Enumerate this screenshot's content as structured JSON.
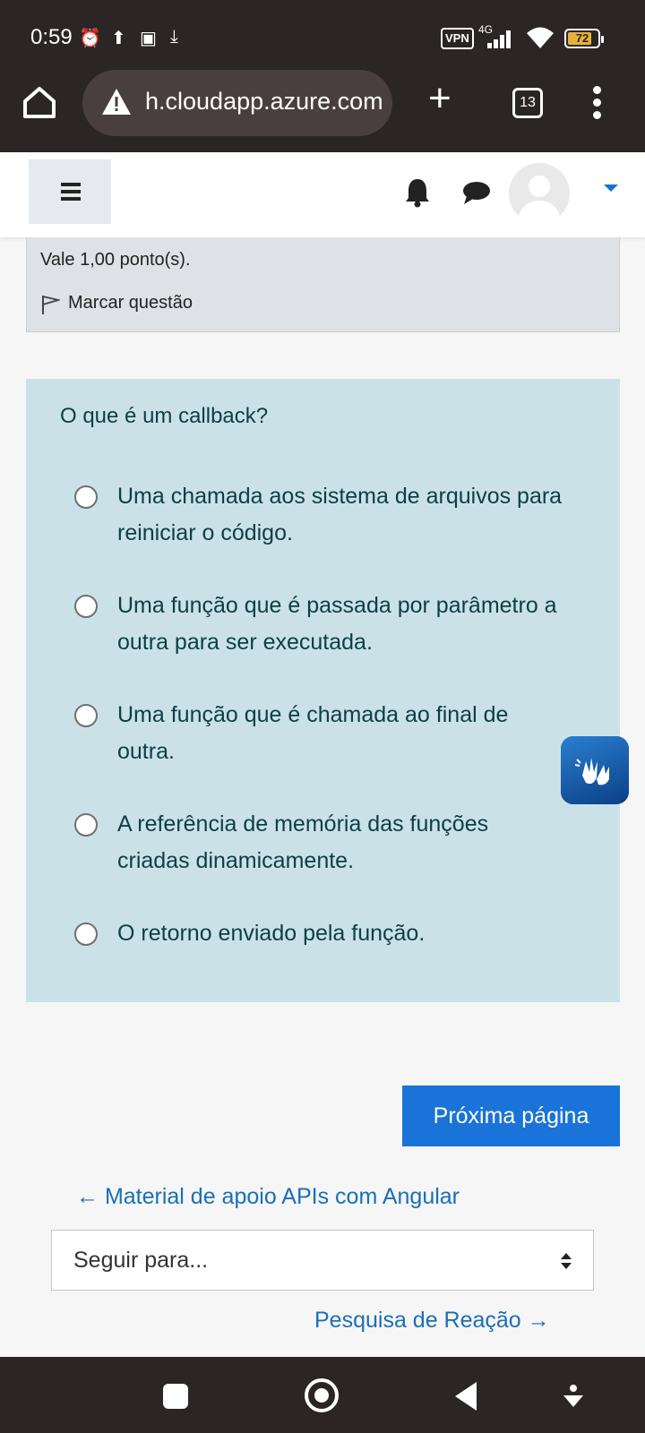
{
  "status_bar": {
    "time": "0:59",
    "vpn": "VPN",
    "network": "4G",
    "battery": "72"
  },
  "browser": {
    "url": "h.cloudapp.azure.com",
    "tab_count": "13"
  },
  "info_panel": {
    "points": "Vale 1,00 ponto(s).",
    "flag_label": "Marcar questão"
  },
  "question": {
    "text": "O que é um callback?",
    "options": [
      "Uma chamada aos sistema de arquivos para reiniciar o código.",
      "Uma função que é passada por parâmetro a outra para ser executada.",
      "Uma função que é chamada ao final de outra.",
      "A referência de memória das funções criadas dinamicamente.",
      "O retorno enviado pela função."
    ]
  },
  "navigation": {
    "next_button": "Próxima página",
    "prev_link": "← Material de apoio APIs com Angular",
    "jump_select": "Seguir para...",
    "next_link": "Pesquisa de Reação →"
  },
  "colors": {
    "question_bg": "#cae2e7",
    "primary": "#1a73d9",
    "link": "#1a6fb8",
    "chrome_bg": "#2b2525"
  }
}
